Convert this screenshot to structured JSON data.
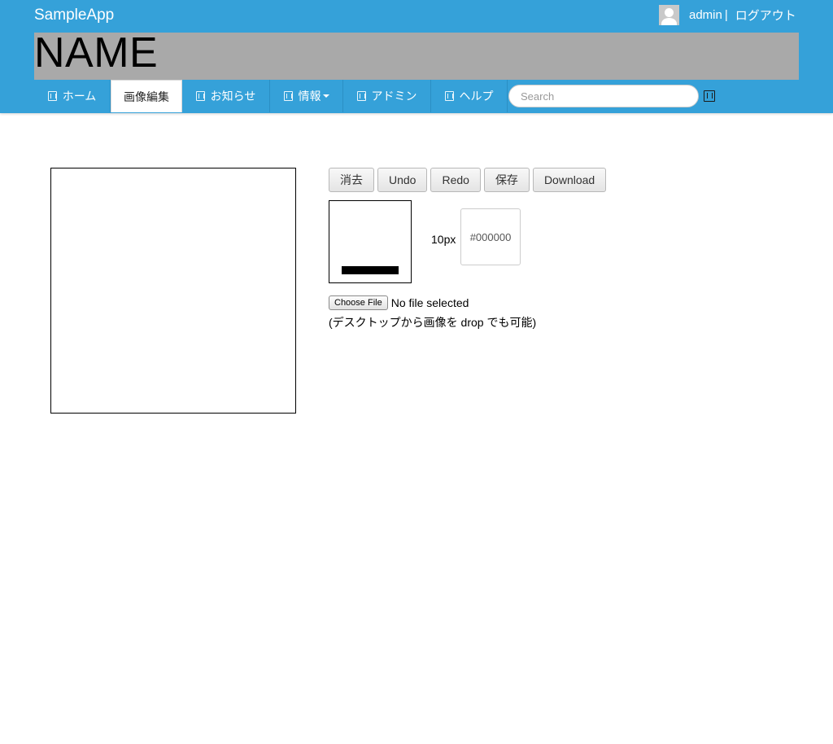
{
  "header": {
    "brand": "SampleApp",
    "user_name": "admin",
    "separator": "|",
    "logout_label": "ログアウト",
    "banner_title": "NAME"
  },
  "nav": {
    "items": [
      {
        "label": "ホーム",
        "icon": "glyph-icon"
      },
      {
        "label": "画像編集"
      },
      {
        "label": "お知らせ",
        "icon": "glyph-icon"
      },
      {
        "label": "情報",
        "icon": "glyph-icon",
        "dropdown": true
      },
      {
        "label": "アドミン",
        "icon": "glyph-icon"
      },
      {
        "label": "ヘルプ",
        "icon": "glyph-icon"
      }
    ],
    "active_index": 1,
    "search_placeholder": "Search"
  },
  "editor": {
    "buttons": {
      "clear": "消去",
      "undo": "Undo",
      "redo": "Redo",
      "save": "保存",
      "download": "Download"
    },
    "brush_size": "10px",
    "color_value": "#000000",
    "file_button_label": "Choose File",
    "file_status": "No file selected",
    "drop_hint": "(デスクトップから画像を drop でも可能)"
  },
  "colors": {
    "header_bg": "#35a1d9",
    "banner_bg": "#a9a9a9",
    "stroke": "#000000"
  }
}
